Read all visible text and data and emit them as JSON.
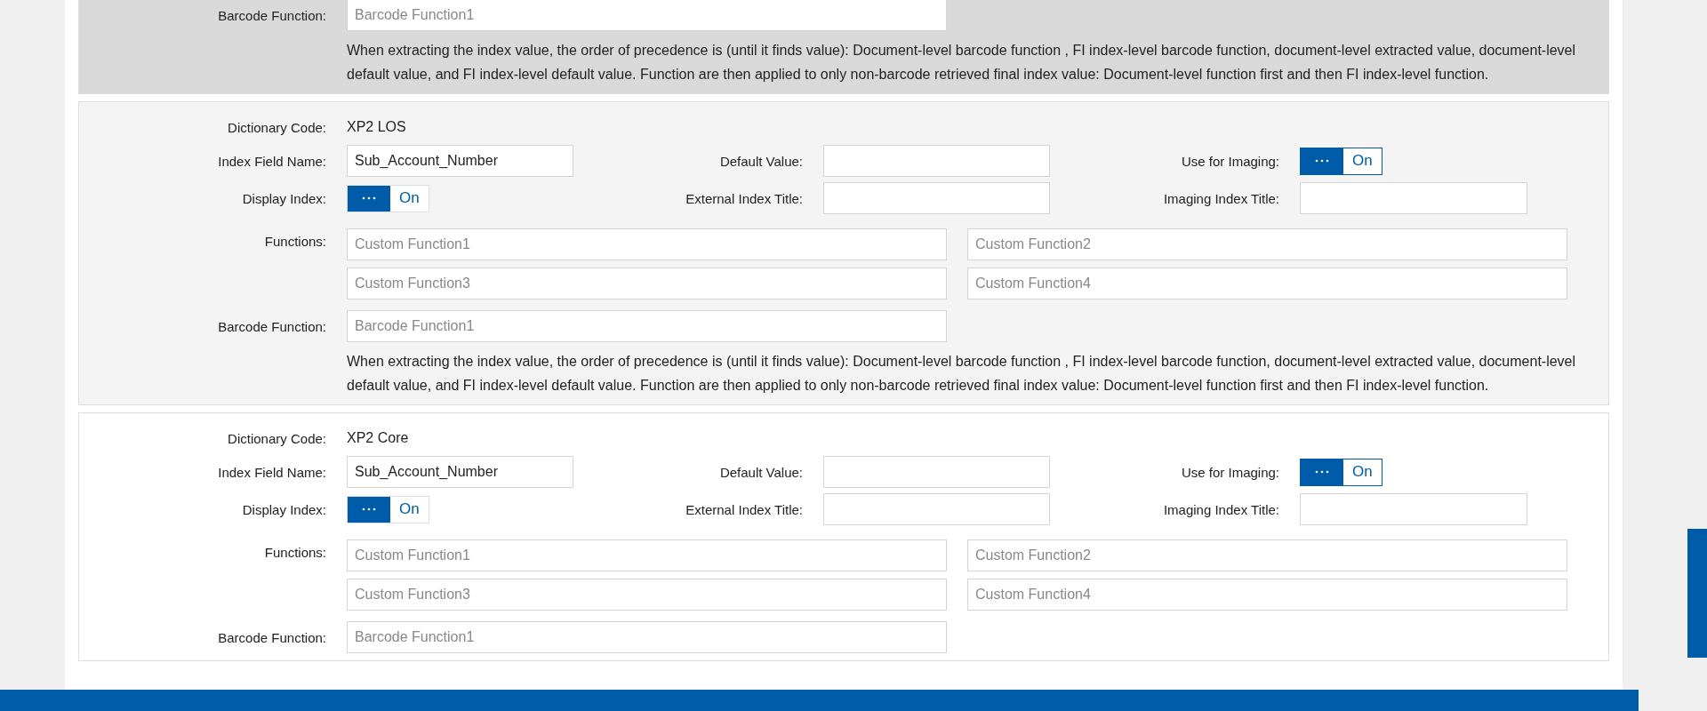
{
  "sections": [
    {
      "color": "#d9d9d9",
      "barcode": {
        "label": "Barcode Function:",
        "placeholder": "Barcode Function1"
      },
      "note": "When extracting the index value, the order of precedence is (until it finds value): Document-level barcode function , FI index-level barcode function, document-level extracted value, document-level default value, and FI index-level default value. Function are then applied to only non-barcode retrieved final index value: Document-level function first and then FI index-level function."
    },
    {
      "color": "#f4f4f4",
      "dictionary": {
        "label": "Dictionary Code:",
        "value": "XP2 LOS"
      },
      "index_field": {
        "label": "Index Field Name:",
        "value": "Sub_Account_Number"
      },
      "default_value": {
        "label": "Default Value:"
      },
      "use_for_imaging": {
        "label": "Use for Imaging:",
        "on": true,
        "text": "On"
      },
      "display_index": {
        "label": "Display Index:",
        "on": true,
        "text": "On"
      },
      "external_title": {
        "label": "External Index Title:"
      },
      "imaging_title": {
        "label": "Imaging Index Title:"
      },
      "functions": {
        "label": "Functions:",
        "placeholders": [
          "Custom Function1",
          "Custom Function2",
          "Custom Function3",
          "Custom Function4"
        ]
      },
      "barcode": {
        "label": "Barcode Function:",
        "placeholder": "Barcode Function1"
      },
      "note": "When extracting the index value, the order of precedence is (until it finds value): Document-level barcode function , FI index-level barcode function, document-level extracted value, document-level default value, and FI index-level default value. Function are then applied to only non-barcode retrieved final index value: Document-level function first and then FI index-level function."
    },
    {
      "color": "#ffffff",
      "dictionary": {
        "label": "Dictionary Code:",
        "value": "XP2 Core"
      },
      "index_field": {
        "label": "Index Field Name:",
        "value": "Sub_Account_Number"
      },
      "default_value": {
        "label": "Default Value:"
      },
      "use_for_imaging": {
        "label": "Use for Imaging:",
        "on": true,
        "text": "On"
      },
      "display_index": {
        "label": "Display Index:",
        "on": true,
        "text": "On"
      },
      "external_title": {
        "label": "External Index Title:"
      },
      "imaging_title": {
        "label": "Imaging Index Title:"
      },
      "functions": {
        "label": "Functions:",
        "placeholders": [
          "Custom Function1",
          "Custom Function2",
          "Custom Function3",
          "Custom Function4"
        ]
      },
      "barcode": {
        "label": "Barcode Function:",
        "placeholder": "Barcode Function1"
      }
    }
  ]
}
